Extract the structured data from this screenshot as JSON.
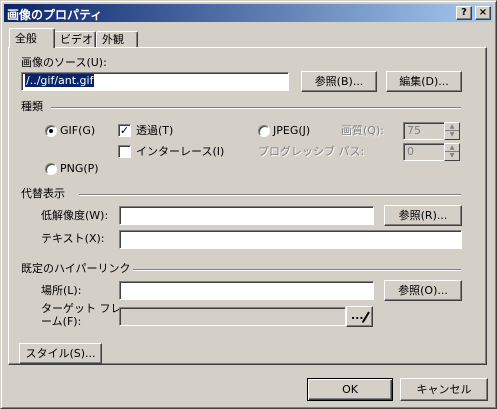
{
  "window": {
    "title": "画像のプロパティ",
    "help_label": "?",
    "close_label": "×"
  },
  "tabs": [
    {
      "label": "全般",
      "active": true
    },
    {
      "label": "ビデオ",
      "active": false
    },
    {
      "label": "外観",
      "active": false
    }
  ],
  "image_source": {
    "label": "画像のソース(U):",
    "value": "/../gif/ant.gif",
    "browse_label": "参照(B)...",
    "edit_label": "編集(D)..."
  },
  "type_group": {
    "title": "種類",
    "gif_label": "GIF(G)",
    "gif_selected": true,
    "transparent_label": "透過(T)",
    "transparent_checked": true,
    "interlace_label": "インターレース(I)",
    "interlace_checked": false,
    "jpeg_label": "JPEG(J)",
    "jpeg_selected": false,
    "quality_label": "画質(Q):",
    "quality_value": "75",
    "progressive_label": "プログレッシブ パス:",
    "progressive_value": "0",
    "png_label": "PNG(P)",
    "png_selected": false
  },
  "alternate_group": {
    "title": "代替表示",
    "low_res_label": "低解像度(W):",
    "low_res_value": "",
    "low_res_browse_label": "参照(R)...",
    "text_label": "テキスト(X):",
    "text_value": ""
  },
  "hyperlink_group": {
    "title": "既定のハイパーリンク",
    "location_label": "場所(L):",
    "location_value": "",
    "location_browse_label": "参照(O)...",
    "target_frame_label_1": "ターゲット フレ",
    "target_frame_label_2": "ーム(F):",
    "target_frame_value": "",
    "target_frame_button_label": "..."
  },
  "style_button_label": "スタイル(S)...",
  "ok_label": "OK",
  "cancel_label": "キャンセル"
}
